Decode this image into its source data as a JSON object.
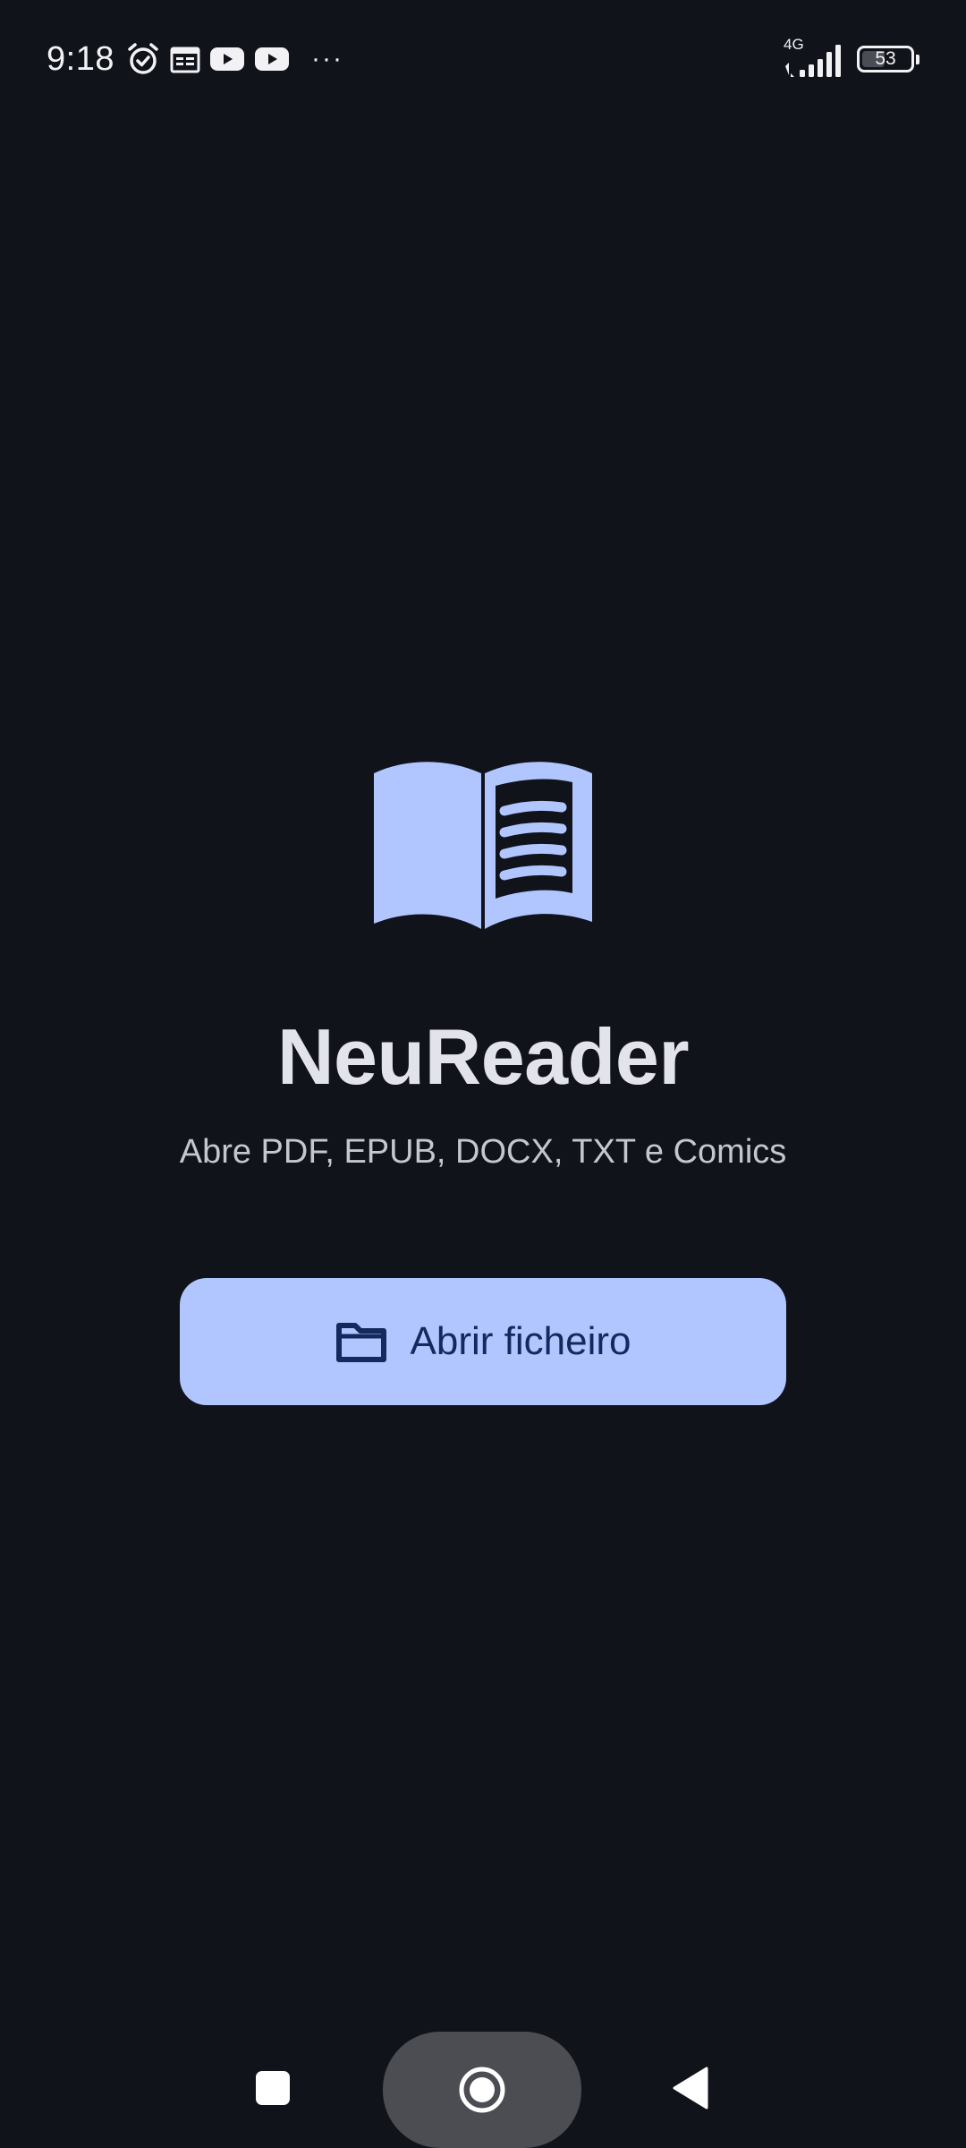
{
  "status_bar": {
    "time": "9:18",
    "network_type": "4G",
    "battery_level": "53",
    "more_indicator": "···",
    "icons": [
      "alarm-icon",
      "calendar-icon",
      "youtube-icon",
      "youtube-icon",
      "signal-icon",
      "battery-icon"
    ]
  },
  "main": {
    "logo_icon": "open-book-icon",
    "title": "NeuReader",
    "subtitle": "Abre PDF, EPUB, DOCX, TXT e Comics",
    "open_button": {
      "icon": "folder-icon",
      "label": "Abrir ficheiro"
    }
  },
  "nav_bar": {
    "items": [
      "recent-apps-button",
      "home-button",
      "back-button"
    ]
  },
  "colors": {
    "background": "#11131a",
    "accent": "#b1c5ff",
    "on_accent": "#132a5c",
    "title": "#e3e3ec",
    "subtitle": "#c4c6d0"
  }
}
